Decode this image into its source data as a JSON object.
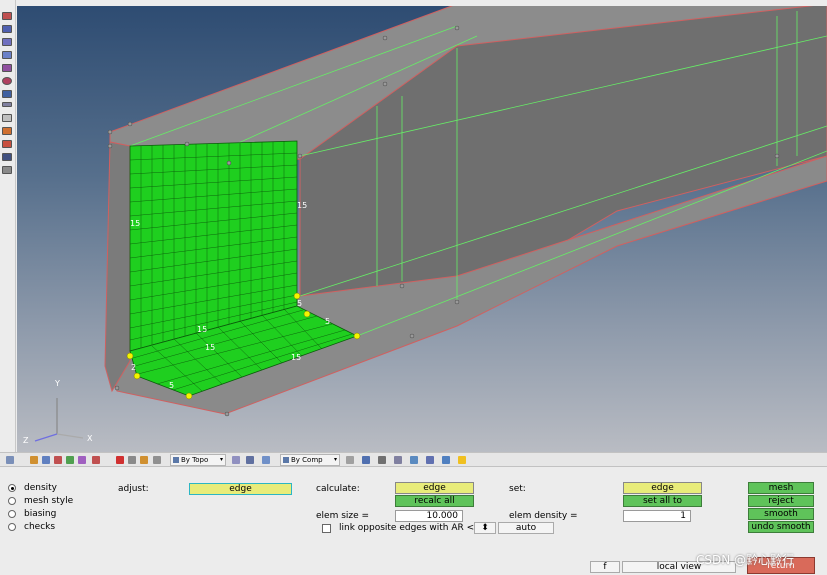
{
  "viewport": {
    "mesh_labels": [
      "15",
      "15",
      "15",
      "15",
      "15",
      "5",
      "2",
      "5",
      "5"
    ],
    "axis": {
      "y": "Y",
      "z": "Z",
      "x": "X"
    }
  },
  "toolbar": {
    "topo_dropdown": "By Topo",
    "comp_dropdown": "By Comp"
  },
  "panel": {
    "modes": [
      {
        "label": "density",
        "selected": true
      },
      {
        "label": "mesh style",
        "selected": false
      },
      {
        "label": "biasing",
        "selected": false
      },
      {
        "label": "checks",
        "selected": false
      }
    ],
    "adjust_label": "adjust:",
    "adjust_value": "edge",
    "calculate_label": "calculate:",
    "calculate_value": "edge",
    "recalc_all": "recalc all",
    "elem_size_label": "elem size =",
    "elem_size_value": "10.000",
    "link_label": "link opposite edges with AR <",
    "auto_label": "auto",
    "set_label": "set:",
    "set_value": "edge",
    "set_all_to": "set all to",
    "elem_density_label": "elem density =",
    "elem_density_value": "1",
    "mesh": "mesh",
    "reject": "reject",
    "smooth": "smooth",
    "undo_smooth": "undo smooth",
    "f_label": "f",
    "local_view": "local view",
    "return": "return"
  },
  "watermark": "CSDN @黔心黔行"
}
